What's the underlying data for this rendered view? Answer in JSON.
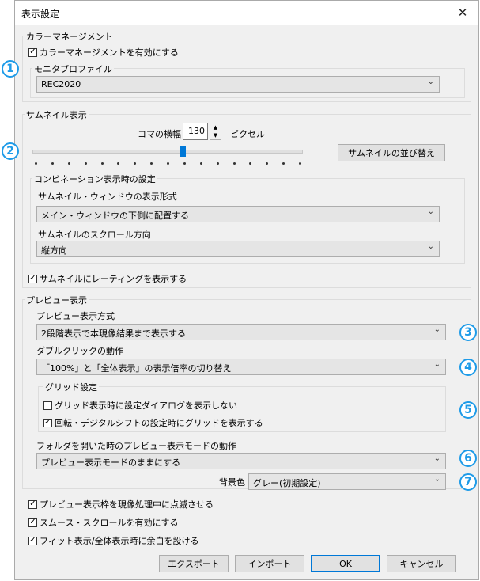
{
  "window": {
    "title": "表示設定",
    "close_glyph": "✕"
  },
  "color_management": {
    "group_label": "カラーマネージメント",
    "enable_checkbox": {
      "label": "カラーマネージメントを有効にする",
      "checked": true
    },
    "monitor_profile": {
      "group_label": "モニタプロファイル",
      "value": "REC2020"
    }
  },
  "thumbnail": {
    "group_label": "サムネイル表示",
    "frame_width": {
      "label": "コマの横幅",
      "value": "130",
      "unit": "ピクセル"
    },
    "slider_level": 0.56,
    "sort_button": "サムネイルの並び替え",
    "combination": {
      "group_label": "コンビネーション表示時の設定",
      "format_label": "サムネイル・ウィンドウの表示形式",
      "format_value": "メイン・ウィンドウの下側に配置する",
      "scroll_label": "サムネイルのスクロール方向",
      "scroll_value": "縦方向"
    },
    "rating_checkbox": {
      "label": "サムネイルにレーティングを表示する",
      "checked": true
    }
  },
  "preview": {
    "group_label": "プレビュー表示",
    "method_label": "プレビュー表示方式",
    "method_value": "2段階表示で本現像結果まで表示する",
    "dblclick_label": "ダブルクリックの動作",
    "dblclick_value": "「100%」と「全体表示」の表示倍率の切り替え",
    "grid": {
      "group_label": "グリッド設定",
      "no_dialog": {
        "label": "グリッド表示時に設定ダイアログを表示しない",
        "checked": false
      },
      "show_on_rotate": {
        "label": "回転・デジタルシフトの設定時にグリッドを表示する",
        "checked": true
      }
    },
    "folder_open_label": "フォルダを開いた時のプレビュー表示モードの動作",
    "folder_open_value": "プレビュー表示モードのままにする",
    "background_label": "背景色",
    "background_value": "グレー(初期設定)"
  },
  "options": [
    {
      "label": "プレビュー表示枠を現像処理中に点滅させる",
      "checked": true
    },
    {
      "label": "スムース・スクロールを有効にする",
      "checked": true
    },
    {
      "label": "フィット表示/全体表示時に余白を設ける",
      "checked": true
    }
  ],
  "buttons": {
    "export": "エクスポート",
    "import": "インポート",
    "ok": "OK",
    "cancel": "キャンセル"
  },
  "callouts": [
    "1",
    "2",
    "3",
    "4",
    "5",
    "6",
    "7"
  ],
  "colors": {
    "callout": "#1e9be8",
    "accent": "#0078d7"
  }
}
